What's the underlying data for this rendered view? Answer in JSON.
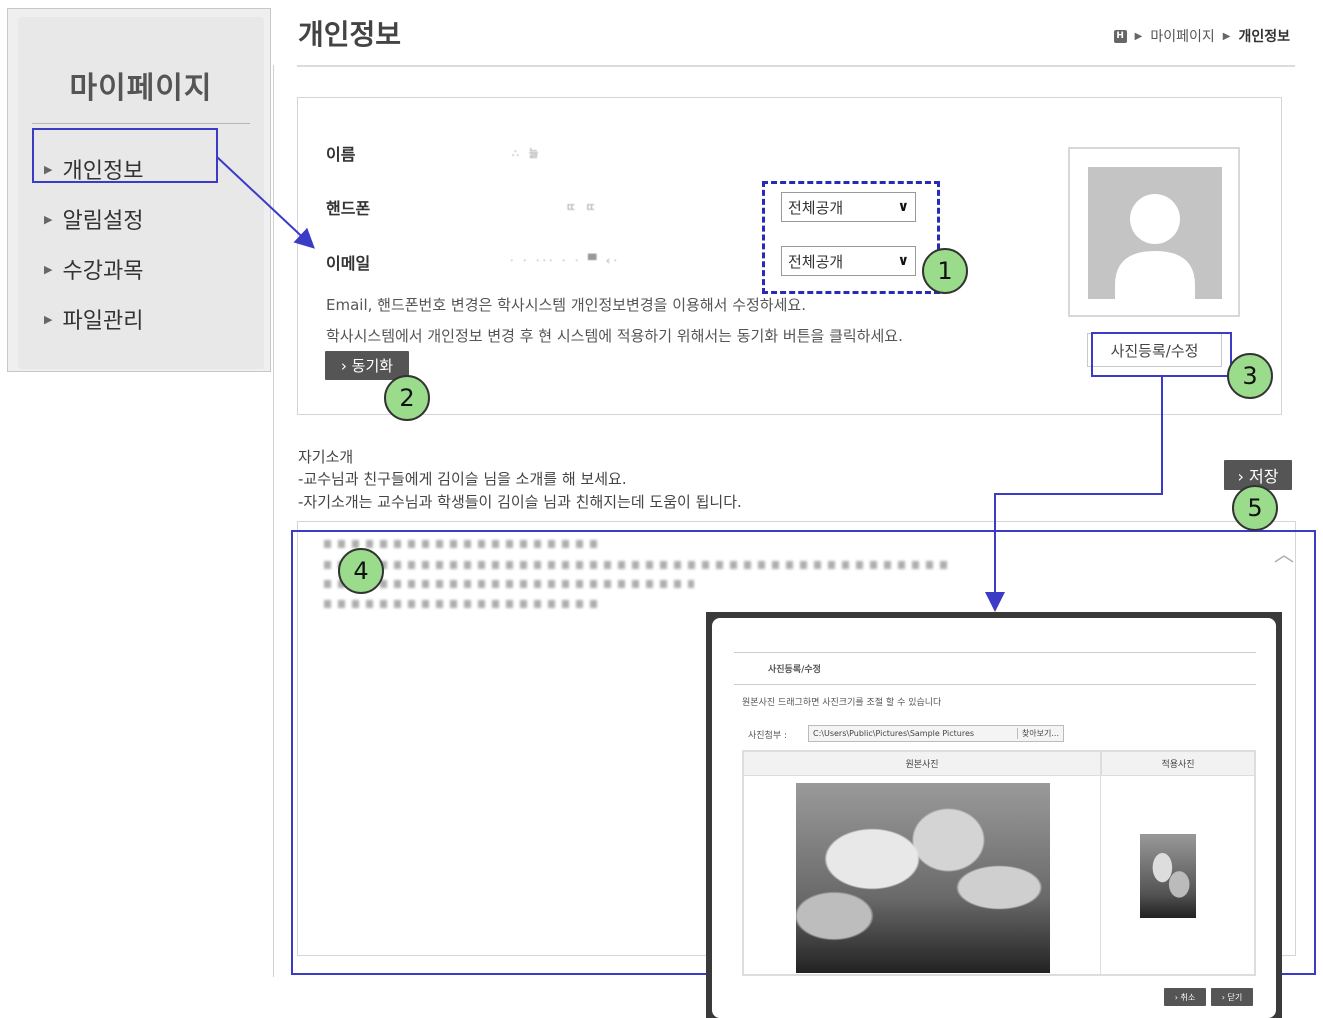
{
  "sidebar": {
    "title": "마이페이지",
    "items": [
      {
        "label": "개인정보"
      },
      {
        "label": "알림설정"
      },
      {
        "label": "수강과목"
      },
      {
        "label": "파일관리"
      }
    ]
  },
  "header": {
    "title": "개인정보",
    "breadcrumb": {
      "home_icon": "H",
      "items": [
        "마이페이지",
        "개인정보"
      ]
    }
  },
  "info": {
    "name_label": "이름",
    "name_value": "∴ 늘",
    "phone_label": "핸드폰",
    "phone_value": "ㄸ  ㄸ",
    "email_label": "이메일",
    "email_value": "· ·  ··· · ·  ▀  ‹·",
    "phone_visibility": "전체공개",
    "email_visibility": "전체공개",
    "notice_1": "Email, 핸드폰번호 변경은 학사시스템 개인정보변경을 이용해서 수정하세요.",
    "notice_2": "학사시스템에서 개인정보 변경 후 현 시스템에 적용하기 위해서는 동기화 버튼을 클릭하세요.",
    "sync_button": "› 동기화"
  },
  "photo": {
    "button_label": "사진등록/수정"
  },
  "intro": {
    "heading": "자기소개",
    "hint_1": "-교수님과 친구들에게 김이슬 님을 소개를 해 보세요.",
    "hint_2": "-자기소개는 교수님과 학생들이 김이슬 님과 친해지는데 도움이 됩니다.",
    "save_button": "› 저장"
  },
  "modal": {
    "title": "사진등록/수정",
    "instruction": "원본사진 드래그하면 사진크기를 조절 할 수 있습니다",
    "file_label": "사진첨부 :",
    "file_path": "C:\\Users\\Public\\Pictures\\Sample Pictures",
    "browse_button": "찾아보기...",
    "col_original": "원본사진",
    "col_applied": "적용사진",
    "cancel_button": "› 취소",
    "close_button": "› 닫기"
  },
  "annotations": [
    "1",
    "2",
    "3",
    "4",
    "5"
  ],
  "colors": {
    "annotation_border": "#3b3bc6",
    "callout_fill": "#9bdc8c",
    "button_bg": "#555555"
  }
}
